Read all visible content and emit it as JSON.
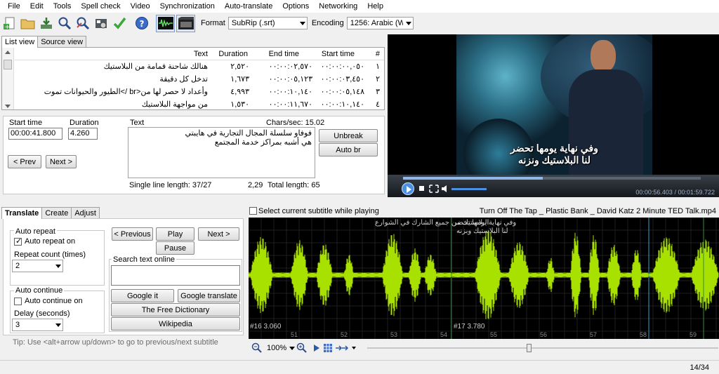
{
  "menu": [
    "File",
    "Edit",
    "Tools",
    "Spell check",
    "Video",
    "Synchronization",
    "Auto-translate",
    "Options",
    "Networking",
    "Help"
  ],
  "toolbar": {
    "icons": [
      "new-icon",
      "open-icon",
      "save-icon",
      "find-icon",
      "replace-icon",
      "fix-common-errors-icon",
      "spell-check-icon",
      "help-icon",
      "waveform-toggle-icon",
      "video-toggle-icon"
    ],
    "format_label": "Format",
    "format_value": "SubRip (.srt)",
    "encoding_label": "Encoding",
    "encoding_value": "1256: Arabic (Windo"
  },
  "top_tabs": [
    "List view",
    "Source view"
  ],
  "list": {
    "columns": [
      "#",
      "Start time",
      "End time",
      "Duration",
      "Text"
    ],
    "rows": [
      {
        "num": "١",
        "start": "٠٠:٠٠:٠٠,٠٥٠",
        "end": "٠٠:٠٠:٠٢,٥٧٠",
        "duration": "٢,٥٢٠",
        "text": "هنالك شاحنة قمامة من البلاستيك"
      },
      {
        "num": "٢",
        "start": "٠٠:٠٠:٠٣,٤٥٠",
        "end": "٠٠:٠٠:٠٥,١٢٣",
        "duration": "١,٦٧٣",
        "text": "تدخل كل دقيقة"
      },
      {
        "num": "٣",
        "start": "٠٠:٠٠:٠٥,١٤٨",
        "end": "٠٠:٠٠:١٠,١٤٠",
        "duration": "٤,٩٩٣",
        "text": "وأعداد لا حصر لها من<br />الطيور والحيوانات تموت"
      },
      {
        "num": "٤",
        "start": "٠٠:٠٠:١٠,١٤٠",
        "end": "٠٠:٠٠:١١,٦٧٠",
        "duration": "١,٥٣٠",
        "text": "من مواجهة البلاستيك"
      }
    ]
  },
  "edit": {
    "start_label": "Start time",
    "start_value": "00:00:41.800",
    "duration_label": "Duration",
    "duration_value": "4.260",
    "text_label": "Text",
    "chars_sec": "Chars/sec: 15.02",
    "text_line1": "فوفاو سلسلة المجال التجارية في هايبتي",
    "text_line2": "هي أشبه بمراكز خدمة المجتمع",
    "unbreak": "Unbreak",
    "auto_br": "Auto br",
    "prev": "< Prev",
    "next": "Next >",
    "single_line": "Single line length: 37/27",
    "ratio": "2,29",
    "total_length": "Total length: 65"
  },
  "video": {
    "subtitle_line1": "وفي نهاية يومها تحضر",
    "subtitle_line2": "لنا البلاستيك ونزنه",
    "time": "00:00:56.403 / 00:01:59.722",
    "progress": 0.47
  },
  "bottom_tabs": [
    "Translate",
    "Create",
    "Adjust"
  ],
  "translate": {
    "auto_repeat_title": "Auto repeat",
    "auto_repeat_on": "Auto repeat on",
    "repeat_count_label": "Repeat count (times)",
    "repeat_count_value": "2",
    "auto_continue_title": "Auto continue",
    "auto_continue_on": "Auto continue on",
    "delay_label": "Delay (seconds)",
    "delay_value": "3",
    "previous": "< Previous",
    "play": "Play",
    "next": "Next >",
    "pause": "Pause",
    "search_online": "Search text online",
    "google_it": "Google it",
    "google_translate": "Google translate",
    "free_dictionary": "The Free Dictionary",
    "wikipedia": "Wikipedia",
    "tip": "Tip: Use <alt+arrow up/down> to go to previous/next subtitle"
  },
  "waveform": {
    "select_current": "Select current subtitle while playing",
    "filename": "Turn Off The Tap _ Plastic Bank _ David Katz 2 Minute TED Talk.mp4",
    "seg_text_left": "البلاستيك من جميع الشارك في الشوارع",
    "seg_text_mid1": "وفي نهاية يومها تحضر",
    "seg_text_mid2": "لنا البلاستيك وبزنه",
    "seg_left_id": "#16  3.060",
    "seg_mid_id": "#17  3.780",
    "ticks": [
      "51",
      "52",
      "53",
      "54",
      "55",
      "56",
      "57",
      "58",
      "59"
    ],
    "zoom": "100%",
    "wave_color": "#a8e000"
  },
  "status": {
    "position": "14/34"
  }
}
